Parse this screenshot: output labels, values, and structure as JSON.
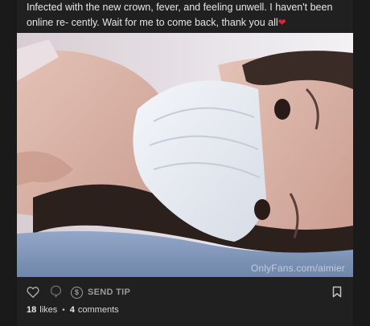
{
  "post": {
    "caption": "Infected with the new crown, fever, and feeling unwell. I haven't been online re- cently. Wait for me to come back, thank you all",
    "caption_emoji": "❤",
    "watermark": "OnlyFans.com/aimier"
  },
  "actions": {
    "like_icon": "heart-outline-icon",
    "comment_icon": "comment-bubble-icon",
    "tip_icon": "dollar-circle-icon",
    "tip_label": "SEND TIP",
    "bookmark_icon": "bookmark-icon"
  },
  "stats": {
    "likes_count": "18",
    "likes_label": "likes",
    "separator": "•",
    "comments_count": "4",
    "comments_label": "comments"
  },
  "colors": {
    "background": "#1a1a1a",
    "card": "#202020",
    "heart_emoji": "#e0223a",
    "muted_icon": "#9a9a9a"
  }
}
